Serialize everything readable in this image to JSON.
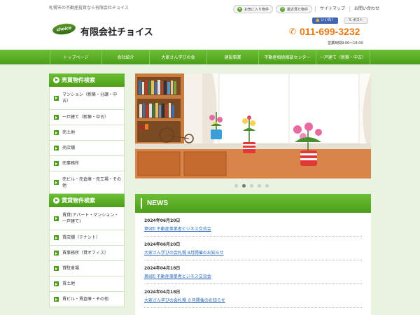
{
  "header": {
    "tagline": "札幌市の不動産投資なら有限会社チョイス",
    "top_links": {
      "favorites": "お気に入り物件",
      "recent": "最近見た物件",
      "sitemap": "サイトマップ",
      "contact": "お問い合わせ"
    },
    "logo_text": "choice",
    "company_name": "有限会社チョイス",
    "social": {
      "facebook": "いいね！",
      "twitter": "ポスト"
    },
    "phone": "011-699-3232",
    "hours": "営業時間9:00～18:00"
  },
  "nav": [
    "トップページ",
    "会社紹介",
    "大家さん学びの会",
    "建設事業",
    "不動産相続相談センター",
    "一戸建て（新築・中古）"
  ],
  "sidebar": {
    "sale_heading": "売買物件検索",
    "sale_items": [
      "マンション（新築・分譲・中古）",
      "一戸建て（新築・中古）",
      "売土地",
      "売店舗",
      "売事務所",
      "売ビル・売倉庫・売工場・その他"
    ],
    "rent_heading": "賃貸物件検索",
    "rent_items": [
      "賃貸(アパート・マンション・一戸建て)",
      "賃店舗（テナント）",
      "賃事務所（貸オフィス）",
      "貸駐車場",
      "賃土地",
      "賃ビル・賃倉庫・その他"
    ]
  },
  "slider": {
    "active_dot": 2,
    "dot_count": 5
  },
  "news": {
    "heading": "NEWS",
    "items": [
      {
        "date": "2024年06月20日",
        "title": "第9回 不動産事業者ビジネス交流会"
      },
      {
        "date": "2024年06月20日",
        "title": "大家さん学びの会札幌 8月開催のお知らせ"
      },
      {
        "date": "2024年04月18日",
        "title": "第8回 不動産事業者ビジネス交流会"
      },
      {
        "date": "2024年04月18日",
        "title": "大家さん学びの会札幌 ６月開催のお知らせ"
      }
    ]
  },
  "colors": {
    "brand_green": "#4c9e1a",
    "phone_orange": "#e97a10",
    "bg_green": "#eaf3df"
  }
}
